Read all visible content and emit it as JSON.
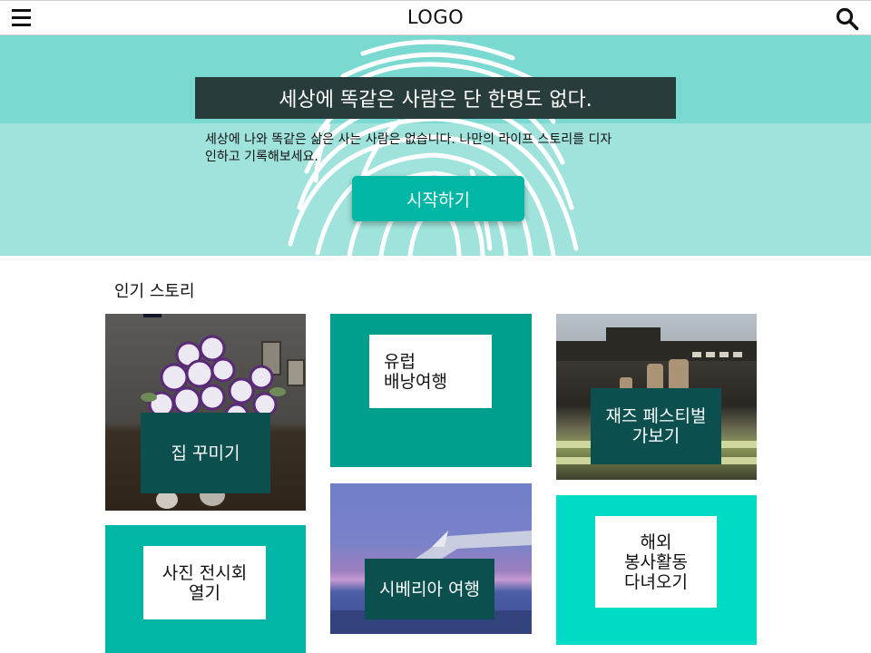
{
  "header": {
    "logo": "LOGO",
    "menu_icon": "hamburger-icon",
    "search_icon": "search-icon"
  },
  "hero": {
    "title": "세상에 똑같은 사람은 단 한명도 없다.",
    "description": "세상에 나와 똑같은 삶은 사는 사람은 없습니다. 나만의 라이프 스토리를 디자인하고 기록해보세요.",
    "cta_label": "시작하기",
    "background_icon": "fingerprint-icon"
  },
  "stories": {
    "title": "인기 스토리",
    "items": [
      {
        "label": "집 꾸미기"
      },
      {
        "label": "유럽\n배낭여행"
      },
      {
        "label": "재즈 페스티벌\n가보기"
      },
      {
        "label": "사진 전시회\n열기"
      },
      {
        "label": "시베리아 여행"
      },
      {
        "label": "해외\n봉사활동\n다녀오기"
      }
    ]
  },
  "colors": {
    "hero_band": "#7ad9d0",
    "hero_bg": "#9fe3dc",
    "hero_title_bg": "#283d3b",
    "cta": "#00b7a6",
    "card_teal_dark": "#009e8c",
    "card_teal": "#00b7a6",
    "card_teal_light": "#00dcc6",
    "label_dark": "#0b4f4f"
  }
}
